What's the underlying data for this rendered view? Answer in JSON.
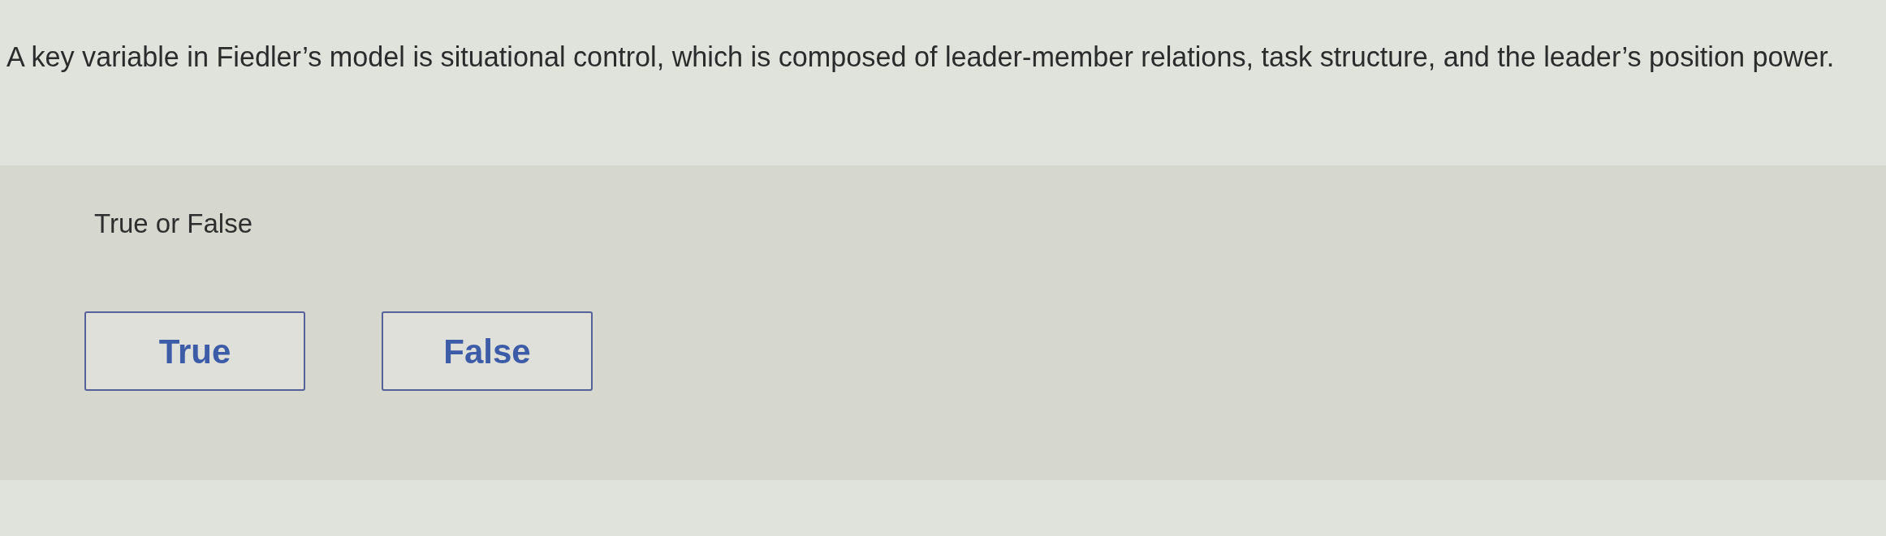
{
  "question": {
    "text": "A key variable in Fiedler’s model is situational control, which is composed of leader-member relations, task structure, and the leader’s position power."
  },
  "prompt": "True or False",
  "options": [
    {
      "label": "True",
      "selected": false
    },
    {
      "label": "False",
      "selected": false
    }
  ]
}
